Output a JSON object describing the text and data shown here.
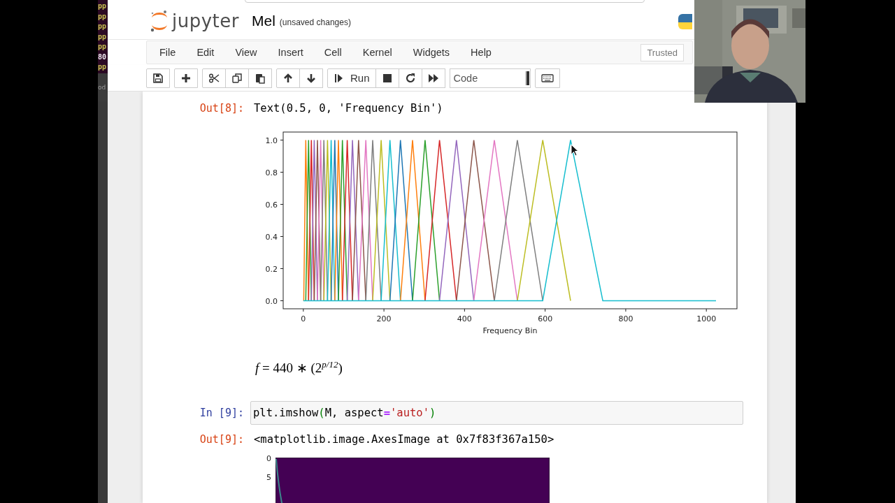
{
  "terminal_strip": {
    "lines": [
      {
        "text": "pp",
        "color": "#c8c050"
      },
      {
        "text": "pp",
        "color": "#c8c050"
      },
      {
        "text": "pp",
        "color": "#c8c050"
      },
      {
        "text": "pp",
        "color": "#c8c050"
      },
      {
        "text": "pp",
        "color": "#c8c050"
      },
      {
        "text": "80",
        "color": "#f0e8f0"
      },
      {
        "text": "pp",
        "color": "#c8c050"
      }
    ],
    "footer": "od"
  },
  "header": {
    "app_name": "jupyter",
    "notebook_title": "Mel",
    "save_status": "(unsaved changes)"
  },
  "menu": [
    "File",
    "Edit",
    "View",
    "Insert",
    "Cell",
    "Kernel",
    "Widgets",
    "Help"
  ],
  "trusted": "Trusted",
  "toolbar": {
    "groups": [
      [
        {
          "kind": "save"
        }
      ],
      [
        {
          "kind": "add"
        }
      ],
      [
        {
          "kind": "cut"
        },
        {
          "kind": "copy"
        },
        {
          "kind": "paste"
        }
      ],
      [
        {
          "kind": "up"
        },
        {
          "kind": "down"
        }
      ],
      [
        {
          "kind": "run",
          "label": "Run"
        },
        {
          "kind": "stop"
        },
        {
          "kind": "restart"
        },
        {
          "kind": "fast_forward"
        }
      ],
      [
        {
          "kind": "select",
          "value": "Code"
        }
      ],
      [
        {
          "kind": "keyboard"
        }
      ]
    ]
  },
  "cells": [
    {
      "kind": "output",
      "prompt": "Out[8]:",
      "text": "Text(0.5, 0, 'Frequency Bin')"
    },
    {
      "kind": "chart",
      "chart_data": {
        "type": "line",
        "xlabel": "Frequency Bin",
        "xlim": [
          -50,
          1076
        ],
        "ylim": [
          -0.05,
          1.05
        ],
        "xticks": [
          0,
          200,
          400,
          600,
          800,
          1000
        ],
        "yticks": [
          {
            "value": 0,
            "label": "0.0"
          },
          {
            "value": 0.2,
            "label": "0.2"
          },
          {
            "value": 0.4,
            "label": "0.4"
          },
          {
            "value": 0.6,
            "label": "0.6"
          },
          {
            "value": 0.8,
            "label": "0.8"
          },
          {
            "value": 1,
            "label": "1.0"
          }
        ],
        "x": [
          0,
          1,
          6,
          13,
          20,
          27,
          35,
          43,
          51,
          60,
          69,
          78,
          87,
          97,
          109,
          122,
          137,
          155,
          172,
          193,
          215,
          241,
          271,
          302,
          338,
          380,
          423,
          474,
          531,
          594,
          663,
          743,
          1024
        ],
        "series": [
          {
            "color": "#ff7f0e",
            "values": [
              null,
              0,
              1,
              0,
              null,
              null,
              null,
              null,
              null,
              null,
              null,
              null,
              null,
              null,
              null,
              null,
              null,
              null,
              null,
              null,
              null,
              null,
              null,
              null,
              null,
              null,
              null,
              null,
              null,
              null,
              null,
              null,
              null
            ]
          },
          {
            "color": "#2ca02c",
            "values": [
              null,
              null,
              0,
              1,
              0,
              null,
              null,
              null,
              null,
              null,
              null,
              null,
              null,
              null,
              null,
              null,
              null,
              null,
              null,
              null,
              null,
              null,
              null,
              null,
              null,
              null,
              null,
              null,
              null,
              null,
              null,
              null,
              null
            ]
          },
          {
            "color": "#d62728",
            "values": [
              null,
              null,
              null,
              0,
              1,
              0,
              null,
              null,
              null,
              null,
              null,
              null,
              null,
              null,
              null,
              null,
              null,
              null,
              null,
              null,
              null,
              null,
              null,
              null,
              null,
              null,
              null,
              null,
              null,
              null,
              null,
              null,
              null
            ]
          },
          {
            "color": "#9467bd",
            "values": [
              null,
              null,
              null,
              null,
              0,
              1,
              0,
              null,
              null,
              null,
              null,
              null,
              null,
              null,
              null,
              null,
              null,
              null,
              null,
              null,
              null,
              null,
              null,
              null,
              null,
              null,
              null,
              null,
              null,
              null,
              null,
              null,
              null
            ]
          },
          {
            "color": "#8c564b",
            "values": [
              null,
              null,
              null,
              null,
              null,
              0,
              1,
              0,
              null,
              null,
              null,
              null,
              null,
              null,
              null,
              null,
              null,
              null,
              null,
              null,
              null,
              null,
              null,
              null,
              null,
              null,
              null,
              null,
              null,
              null,
              null,
              null,
              null
            ]
          },
          {
            "color": "#e377c2",
            "values": [
              null,
              null,
              null,
              null,
              null,
              null,
              0,
              1,
              0,
              null,
              null,
              null,
              null,
              null,
              null,
              null,
              null,
              null,
              null,
              null,
              null,
              null,
              null,
              null,
              null,
              null,
              null,
              null,
              null,
              null,
              null,
              null,
              null
            ]
          },
          {
            "color": "#7f7f7f",
            "values": [
              null,
              null,
              null,
              null,
              null,
              null,
              null,
              0,
              1,
              0,
              null,
              null,
              null,
              null,
              null,
              null,
              null,
              null,
              null,
              null,
              null,
              null,
              null,
              null,
              null,
              null,
              null,
              null,
              null,
              null,
              null,
              null,
              null
            ]
          },
          {
            "color": "#bcbd22",
            "values": [
              null,
              null,
              null,
              null,
              null,
              null,
              null,
              null,
              0,
              1,
              0,
              null,
              null,
              null,
              null,
              null,
              null,
              null,
              null,
              null,
              null,
              null,
              null,
              null,
              null,
              null,
              null,
              null,
              null,
              null,
              null,
              null,
              null
            ]
          },
          {
            "color": "#17becf",
            "values": [
              null,
              null,
              null,
              null,
              null,
              null,
              null,
              null,
              null,
              0,
              1,
              0,
              null,
              null,
              null,
              null,
              null,
              null,
              null,
              null,
              null,
              null,
              null,
              null,
              null,
              null,
              null,
              null,
              null,
              null,
              null,
              null,
              null
            ]
          },
          {
            "color": "#1f77b4",
            "values": [
              null,
              null,
              null,
              null,
              null,
              null,
              null,
              null,
              null,
              null,
              0,
              1,
              0,
              null,
              null,
              null,
              null,
              null,
              null,
              null,
              null,
              null,
              null,
              null,
              null,
              null,
              null,
              null,
              null,
              null,
              null,
              null,
              null
            ]
          },
          {
            "color": "#ff7f0e",
            "values": [
              null,
              null,
              null,
              null,
              null,
              null,
              null,
              null,
              null,
              null,
              null,
              0,
              1,
              0,
              null,
              null,
              null,
              null,
              null,
              null,
              null,
              null,
              null,
              null,
              null,
              null,
              null,
              null,
              null,
              null,
              null,
              null,
              null
            ]
          },
          {
            "color": "#2ca02c",
            "values": [
              null,
              null,
              null,
              null,
              null,
              null,
              null,
              null,
              null,
              null,
              null,
              null,
              0,
              1,
              0,
              null,
              null,
              null,
              null,
              null,
              null,
              null,
              null,
              null,
              null,
              null,
              null,
              null,
              null,
              null,
              null,
              null,
              null
            ]
          },
          {
            "color": "#d62728",
            "values": [
              null,
              null,
              null,
              null,
              null,
              null,
              null,
              null,
              null,
              null,
              null,
              null,
              null,
              0,
              1,
              0,
              null,
              null,
              null,
              null,
              null,
              null,
              null,
              null,
              null,
              null,
              null,
              null,
              null,
              null,
              null,
              null,
              null
            ]
          },
          {
            "color": "#9467bd",
            "values": [
              null,
              null,
              null,
              null,
              null,
              null,
              null,
              null,
              null,
              null,
              null,
              null,
              null,
              null,
              0,
              1,
              0,
              null,
              null,
              null,
              null,
              null,
              null,
              null,
              null,
              null,
              null,
              null,
              null,
              null,
              null,
              null,
              null
            ]
          },
          {
            "color": "#8c564b",
            "values": [
              null,
              null,
              null,
              null,
              null,
              null,
              null,
              null,
              null,
              null,
              null,
              null,
              null,
              null,
              null,
              0,
              1,
              0,
              null,
              null,
              null,
              null,
              null,
              null,
              null,
              null,
              null,
              null,
              null,
              null,
              null,
              null,
              null
            ]
          },
          {
            "color": "#e377c2",
            "values": [
              null,
              null,
              null,
              null,
              null,
              null,
              null,
              null,
              null,
              null,
              null,
              null,
              null,
              null,
              null,
              null,
              0,
              1,
              0,
              null,
              null,
              null,
              null,
              null,
              null,
              null,
              null,
              null,
              null,
              null,
              null,
              null,
              null
            ]
          },
          {
            "color": "#7f7f7f",
            "values": [
              null,
              null,
              null,
              null,
              null,
              null,
              null,
              null,
              null,
              null,
              null,
              null,
              null,
              null,
              null,
              null,
              null,
              0,
              1,
              0,
              null,
              null,
              null,
              null,
              null,
              null,
              null,
              null,
              null,
              null,
              null,
              null,
              null
            ]
          },
          {
            "color": "#bcbd22",
            "values": [
              null,
              null,
              null,
              null,
              null,
              null,
              null,
              null,
              null,
              null,
              null,
              null,
              null,
              null,
              null,
              null,
              null,
              null,
              0,
              1,
              0,
              null,
              null,
              null,
              null,
              null,
              null,
              null,
              null,
              null,
              null,
              null,
              null
            ]
          },
          {
            "color": "#17becf",
            "values": [
              null,
              null,
              null,
              null,
              null,
              null,
              null,
              null,
              null,
              null,
              null,
              null,
              null,
              null,
              null,
              null,
              null,
              null,
              null,
              0,
              1,
              0,
              null,
              null,
              null,
              null,
              null,
              null,
              null,
              null,
              null,
              null,
              null
            ]
          },
          {
            "color": "#1f77b4",
            "values": [
              null,
              null,
              null,
              null,
              null,
              null,
              null,
              null,
              null,
              null,
              null,
              null,
              null,
              null,
              null,
              null,
              null,
              null,
              null,
              null,
              0,
              1,
              0,
              null,
              null,
              null,
              null,
              null,
              null,
              null,
              null,
              null,
              null
            ]
          },
          {
            "color": "#ff7f0e",
            "values": [
              null,
              null,
              null,
              null,
              null,
              null,
              null,
              null,
              null,
              null,
              null,
              null,
              null,
              null,
              null,
              null,
              null,
              null,
              null,
              null,
              null,
              0,
              1,
              0,
              null,
              null,
              null,
              null,
              null,
              null,
              null,
              null,
              null
            ]
          },
          {
            "color": "#2ca02c",
            "values": [
              null,
              null,
              null,
              null,
              null,
              null,
              null,
              null,
              null,
              null,
              null,
              null,
              null,
              null,
              null,
              null,
              null,
              null,
              null,
              null,
              null,
              null,
              0,
              1,
              0,
              null,
              null,
              null,
              null,
              null,
              null,
              null,
              null
            ]
          },
          {
            "color": "#d62728",
            "values": [
              null,
              null,
              null,
              null,
              null,
              null,
              null,
              null,
              null,
              null,
              null,
              null,
              null,
              null,
              null,
              null,
              null,
              null,
              null,
              null,
              null,
              null,
              null,
              0,
              1,
              0,
              null,
              null,
              null,
              null,
              null,
              null,
              null
            ]
          },
          {
            "color": "#9467bd",
            "values": [
              null,
              null,
              null,
              null,
              null,
              null,
              null,
              null,
              null,
              null,
              null,
              null,
              null,
              null,
              null,
              null,
              null,
              null,
              null,
              null,
              null,
              null,
              null,
              null,
              0,
              1,
              0,
              null,
              null,
              null,
              null,
              null,
              null
            ]
          },
          {
            "color": "#8c564b",
            "values": [
              null,
              null,
              null,
              null,
              null,
              null,
              null,
              null,
              null,
              null,
              null,
              null,
              null,
              null,
              null,
              null,
              null,
              null,
              null,
              null,
              null,
              null,
              null,
              null,
              null,
              0,
              1,
              0,
              null,
              null,
              null,
              null,
              null
            ]
          },
          {
            "color": "#e377c2",
            "values": [
              null,
              null,
              null,
              null,
              null,
              null,
              null,
              null,
              null,
              null,
              null,
              null,
              null,
              null,
              null,
              null,
              null,
              null,
              null,
              null,
              null,
              null,
              null,
              null,
              null,
              null,
              0,
              1,
              0,
              null,
              null,
              null,
              null
            ]
          },
          {
            "color": "#7f7f7f",
            "values": [
              null,
              null,
              null,
              null,
              null,
              null,
              null,
              null,
              null,
              null,
              null,
              null,
              null,
              null,
              null,
              null,
              null,
              null,
              null,
              null,
              null,
              null,
              null,
              null,
              null,
              null,
              null,
              0,
              1,
              0,
              null,
              null,
              null
            ]
          },
          {
            "color": "#bcbd22",
            "values": [
              null,
              null,
              null,
              null,
              null,
              null,
              null,
              null,
              null,
              null,
              null,
              null,
              null,
              null,
              null,
              null,
              null,
              null,
              null,
              null,
              null,
              null,
              null,
              null,
              null,
              null,
              null,
              null,
              0,
              1,
              0,
              null,
              null
            ]
          },
          {
            "color": "#17becf",
            "values": [
              0,
              0,
              0,
              0,
              0,
              0,
              0,
              0,
              0,
              0,
              0,
              0,
              0,
              0,
              0,
              0,
              0,
              0,
              0,
              0,
              0,
              0,
              0,
              0,
              0,
              0,
              0,
              0,
              0,
              0,
              1,
              0,
              0
            ]
          }
        ]
      }
    },
    {
      "kind": "markdown",
      "text": "*f* = 440 ∗ (2$^{p/12}$)"
    },
    {
      "kind": "code",
      "prompt": "In [9]:",
      "tokens": [
        {
          "kind": "name",
          "text": "plt.imshow"
        },
        {
          "kind": "paren",
          "text": "("
        },
        {
          "kind": "name",
          "text": "M, aspect"
        },
        {
          "kind": "operator",
          "text": "="
        },
        {
          "kind": "string",
          "text": "'auto'"
        },
        {
          "kind": "paren",
          "text": ")"
        }
      ]
    },
    {
      "kind": "output",
      "prompt": "Out[9]:",
      "text": "<matplotlib.image.AxesImage at 0x7f83f367a150>"
    },
    {
      "kind": "image_plot",
      "yticks": [
        "0",
        "5"
      ]
    }
  ]
}
